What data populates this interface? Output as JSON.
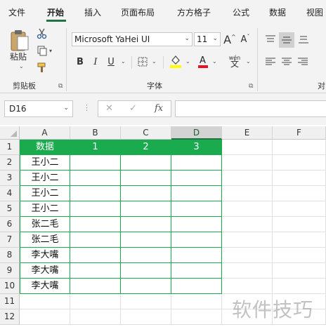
{
  "tabs": [
    {
      "label": "文件",
      "active": false
    },
    {
      "label": "开始",
      "active": true
    },
    {
      "label": "插入",
      "active": false
    },
    {
      "label": "页面布局",
      "active": false
    },
    {
      "label": "方方格子",
      "active": false
    },
    {
      "label": "公式",
      "active": false
    },
    {
      "label": "数据",
      "active": false
    },
    {
      "label": "视图",
      "active": false
    }
  ],
  "ribbon": {
    "clipboard": {
      "paste_label": "粘贴",
      "group_label": "剪贴板"
    },
    "font": {
      "font_name": "Microsoft YaHei UI",
      "font_size": "11",
      "group_label": "字体",
      "bold": "B",
      "italic": "I",
      "underline": "U",
      "grow": "A",
      "shrink": "A",
      "fill_color": "#ffff00",
      "font_color": "#e81123",
      "phonetic_top": "wén",
      "phonetic_bottom": "文"
    },
    "alignment": {
      "group_label": "对"
    }
  },
  "formula_bar": {
    "name_box": "D16",
    "cancel": "✕",
    "confirm": "✓",
    "fx": "fx",
    "formula": ""
  },
  "grid": {
    "columns": [
      "A",
      "B",
      "C",
      "D",
      "E",
      "F"
    ],
    "selected_column": "D",
    "rows": [
      "1",
      "2",
      "3",
      "4",
      "5",
      "6",
      "7",
      "8",
      "9",
      "10",
      "11",
      "12"
    ],
    "header_row": [
      "数据",
      "1",
      "2",
      "3"
    ],
    "data_col_a": [
      "王小二",
      "王小二",
      "王小二",
      "王小二",
      "张二毛",
      "张二毛",
      "李大嘴",
      "李大嘴",
      "李大嘴"
    ],
    "accent_color": "#1aab4f"
  },
  "watermark": "软件技巧"
}
